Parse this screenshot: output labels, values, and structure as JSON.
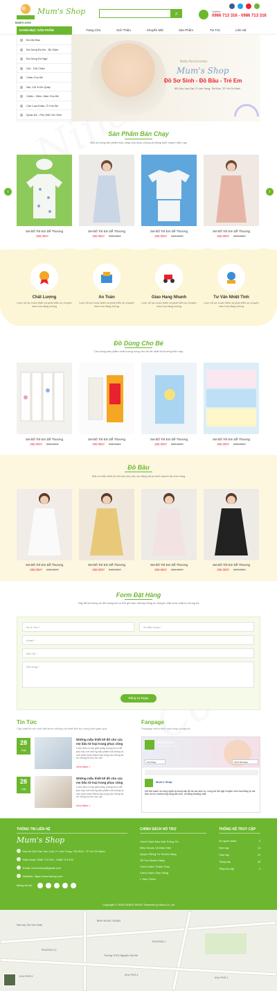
{
  "header": {
    "logo_text": "BABYLOGO",
    "brand": "Mum's Shop",
    "search_placeholder": "",
    "hotline_label": "Hotline:",
    "hotline_number": "0986 713 316 - 0986 713 316"
  },
  "nav": {
    "category_title": "DANH MỤC SẢN PHẨM",
    "items": [
      "Trang Chủ",
      "Giới Thiệu",
      "Khuyến Mãi",
      "Sản Phẩm",
      "Tin Tức",
      "Liên Hệ"
    ]
  },
  "sidebar": {
    "items": [
      "Đồ Mẹ Bầu",
      "Đồ Dùng Đồ Bú - Ăn Dặm",
      "Đồ Dùng Đồ Ngủ",
      "Gối - Gối Chặn",
      "Chăn Cho Bé",
      "Nôi, Cũi & Đồ Quây",
      "Chiếu - Đệm, Màn Cho Bé",
      "Các Loại Khăn, Ô Cho Bé",
      "Quần Áo - Phụ Kiện Sơ Sinh"
    ]
  },
  "banner": {
    "subtitle": "Baby Accessories",
    "title": "Mum's Shop",
    "tagline": "Đồ Sơ Sinh - Đồ Bầu - Trẻ Em",
    "address": "831 Khu Vạn Cần, P. Linh Trung, Thủ Đức, TP. Hồ Chí Minh"
  },
  "best_sellers": {
    "title": "Sản Phẩm Bán Chạy",
    "subtitle": "Một số dòng sản phẩm bán chạy của shop chúng tôi đang kinh doanh hiện nay",
    "products": [
      {
        "name": "Set Đồ Trẻ Em Dễ Thương",
        "price": "250.000₫",
        "old_price": ""
      },
      {
        "name": "Set Đồ Trẻ Em Dễ Thương",
        "price": "250.000₫",
        "old_price": "500.000₫"
      },
      {
        "name": "Set Đồ Trẻ Em Dễ Thương",
        "price": "250.000₫",
        "old_price": "500.000₫"
      },
      {
        "name": "Set Đồ Trẻ Em Dễ Thương",
        "price": "250.000₫",
        "old_price": "500.000₫"
      }
    ]
  },
  "features": [
    {
      "title": "Chất Lượng",
      "desc": "Luôn nỗ lực hoàn thiện và phát triển sự chuyên môn hoá bằng những"
    },
    {
      "title": "An Toàn",
      "desc": "Luôn nỗ lực hoàn thiện và phát triển sự chuyên môn hoá bằng những"
    },
    {
      "title": "Giao Hang Nhanh",
      "desc": "Luôn nỗ lực hoàn thiện và phát triển sự chuyên môn hoá bằng những"
    },
    {
      "title": "Tư Vấn Nhiệt Tình",
      "desc": "Luôn nỗ lực hoàn thiện và phát triển sự chuyên môn hoá bằng những"
    }
  ],
  "baby_items": {
    "title": "Đồ Dùng Cho Bé",
    "subtitle": "Các dòng sản phẩm chất lượng cùng cho bé tốt nhất thị trường hiện nay",
    "products": [
      {
        "name": "Set Đồ Trẻ Em Dễ Thương",
        "price": "250.000₫",
        "old_price": "500.000₫"
      },
      {
        "name": "Set Đồ Trẻ Em Dễ Thương",
        "price": "250.000₫",
        "old_price": "500.000₫"
      },
      {
        "name": "Set Đồ Trẻ Em Dễ Thương",
        "price": "250.000₫",
        "old_price": "500.000₫"
      },
      {
        "name": "Set Đồ Trẻ Em Dễ Thương",
        "price": "250.000₫",
        "old_price": "500.000₫"
      }
    ]
  },
  "maternity": {
    "title": "Đồ Bầu",
    "subtitle": "Một số mẫu thiết kế đồ bầu cho các mẹ đang được kinh doanh tại cửa hàng",
    "products": [
      {
        "name": "Set Đồ Trẻ Em Dễ Thương",
        "price": "250.000₫",
        "old_price": "500.000₫"
      },
      {
        "name": "Set Đồ Trẻ Em Dễ Thương",
        "price": "250.000₫",
        "old_price": "500.000₫"
      },
      {
        "name": "Set Đồ Trẻ Em Dễ Thương",
        "price": "250.000₫",
        "old_price": "500.000₫"
      },
      {
        "name": "Set Đồ Trẻ Em Dễ Thương",
        "price": "250.000₫",
        "old_price": "500.000₫"
      }
    ]
  },
  "order_form": {
    "title": "Form Đặt Hàng",
    "subtitle": "Hãy để lại thông tin để chúng tôi có thể gửi bạn những thông tin khuyến mãi sớm nhất từ chúng tôi",
    "name_ph": "Họ & Tên *",
    "phone_ph": "Số điện thoại *",
    "email_ph": "Email *",
    "address_ph": "Địa Chỉ *",
    "content_ph": "Nội dung *",
    "submit": "Đăng Ký Ngay"
  },
  "news": {
    "title": "Tin Tức",
    "subtitle": "Cập nhật tin tức mới bắt được những cái nhất liên tục trong thời gian qua",
    "items": [
      {
        "day": "28",
        "month": "July",
        "title": "Những mẫu thiết kế đồ cho các mẹ bầu từ loại trang phục cũng",
        "desc": "Luôn đưa ra các giải pháp chúng ta có để phù hợp với những sản phẩm mà chúng ta cần phải hoàn thành tay cùng các thông tin về chúng ta cho cục lạc.",
        "more": "Xem thêm »"
      },
      {
        "day": "28",
        "month": "July",
        "title": "Những mẫu thiết kế đồ cho các mẹ bầu từ loại trang phục cũng",
        "desc": "Luôn đưa ra các giải pháp chúng ta có để phù hợp với những sản phẩm mà chúng ta cần phải hoàn thành tay cùng các thông tin về chúng ta cho cục lạc.",
        "more": "Xem thêm »"
      }
    ]
  },
  "fanpage": {
    "title": "Fanpage",
    "subtitle": "Fanpage chính thức của shop chúng tôi",
    "page_name": "MUM'S SHOP",
    "likes": "22 Thông 7 lúc 5:19",
    "like_btn": "Like Page",
    "send_btn": "Send Message",
    "post_name": "Mum's Shop",
    "post_text": "Hôi thế mạnh về công nghệ và trong cấp độ đồ các dịch vụ, cùng với đội ngũ chuyên môn hoá bằng tự cải đàn nới sự chất lượng cùng tiêu trúc, và đảng khoảng chất."
  },
  "footer": {
    "contact_title": "THÔNG TIN LIÊN HỆ",
    "brand": "Mum's Shop",
    "address": "Địa chỉ 831 Khu Vạn Cần, P. Linh Trung, Thủ Đức, TP Hồ Chí Minh",
    "phone": "Điện thoại: 0986 713 316 - 0986 713 316",
    "email": "Email: mum'sshop@gmail.com",
    "website": "Website: https://mum'sshop.com",
    "social_label": "Mạng xã hội:",
    "support_title": "CHÍNH SÁCH HỖ TRỢ",
    "support_items": [
      "Chính Sách Bảo Mật Thông Tin",
      "Điều Khoản Và Điều Kiện",
      "Quyền Riêng Tư Khách Hàng",
      "Hỗ Trợ Khách Hàng",
      "Chính Sách Thanh Toán",
      "Chính Sách Giao Hàng",
      "» Xem Thêm"
    ],
    "stats_title": "THỐNG KÊ TRUY CẬP",
    "stats": [
      {
        "label": "Số người online",
        "value": "0"
      },
      {
        "label": "Hôm nay",
        "value": "10"
      },
      {
        "label": "Tuần này",
        "value": "24"
      },
      {
        "label": "Tháng này",
        "value": "35"
      },
      {
        "label": "Tổng truy cập",
        "value": "0"
      }
    ],
    "copyright": "Copyright © 2020 MUM'S SHOP. Powered by Nina Co.,Ltd"
  },
  "map": {
    "labels": [
      "BÌNH HƯNG THUẬN",
      "PHƯỜNG 1",
      "PHƯỜNG 12",
      "KHU PHỐ 5",
      "KHU PHỐ 4",
      "KHU PHỐ 1",
      "Trường THCS Nguyễn Văn Bé",
      "Sân bay Tân Sơn Nhất"
    ]
  },
  "colors": {
    "accent": "#6cb72f",
    "sale": "#e8222e",
    "band": "#fdf6d6"
  }
}
